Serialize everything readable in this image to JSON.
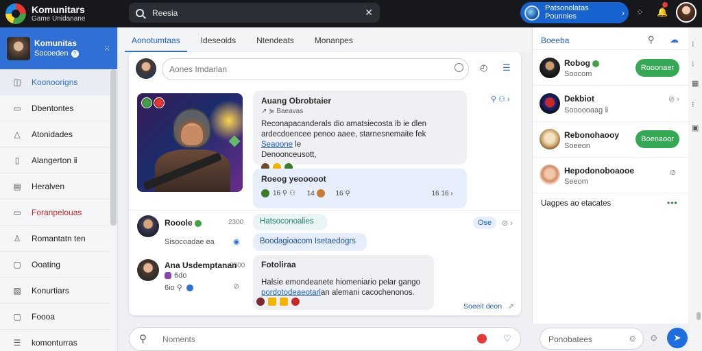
{
  "app": {
    "title": "Komunitars",
    "subtitle": "Game Unidanane"
  },
  "search": {
    "value": "Reesia",
    "clear_icon": "close-icon"
  },
  "account": {
    "name_line1": "Patsonolatas",
    "name_line2": "Pounnies",
    "arrow": "›"
  },
  "sidebar": {
    "user": {
      "name": "Komunitas",
      "sub": "Socoeden",
      "help": "?"
    },
    "items": [
      {
        "label": "Koonoorigns",
        "icon": "◫",
        "state": "active"
      },
      {
        "label": "Dbentontes",
        "icon": "▭",
        "state": ""
      },
      {
        "label": "Atonidades",
        "icon": "△",
        "state": ""
      },
      {
        "label": "Alangerton ⅱ",
        "icon": "▯",
        "state": ""
      },
      {
        "label": "Heralven",
        "icon": "▤",
        "state": ""
      },
      {
        "label": "Foranpelouas",
        "icon": "▭",
        "state": "red"
      },
      {
        "label": "Romantatn ten",
        "icon": "♙",
        "state": ""
      },
      {
        "label": "Ooating",
        "icon": "▢",
        "state": ""
      },
      {
        "label": "Konurtiars",
        "icon": "▧",
        "state": ""
      },
      {
        "label": "Foooa",
        "icon": "▢",
        "state": ""
      },
      {
        "label": "komonturras",
        "icon": "☰",
        "state": ""
      }
    ]
  },
  "tabs": [
    "Aonotumtaas",
    "Ideseolds",
    "Ntendeats",
    "Monanpes"
  ],
  "composer": {
    "placeholder": "Aones Imdarlan"
  },
  "post": {
    "title": "Auang Obrobtaier",
    "meta": "↗ ⋟ Baeavas",
    "body1": "Reconapacanderals dio amatsiecosta ib ie dlen",
    "body2": "ardecdoencee penoo aaee, starnesnemaite fek",
    "link": "Seaoone",
    "body2_tail": "le",
    "body3": "Denoonceusott,",
    "reply_title": "Roeog yeooooot",
    "reply_meta1": "16 ⚲ ⚇",
    "reply_meta2": "14",
    "reply_meta3": "16 ⚲",
    "reply_count": "16 16 ›",
    "share_icon": "⚲ ⚇ ›"
  },
  "comments": [
    {
      "name": "Rooole",
      "sub": "Sisocoadae ea",
      "time": "2300",
      "tag": "Hatsoconoalies",
      "text": "Boodagioacom Isetaedogrs",
      "pill": "Ose",
      "pill_side": "⊘ ›"
    },
    {
      "name": "Ana Usdemptanan",
      "sub1": "6do",
      "sub2": "6io ⚲",
      "time": "2300",
      "title": "Fotoliraa",
      "text1": "Halsie emondeanete hiomeniario pelar gango",
      "link": "pordotodeaeotarl",
      "text2": "an alemani cacochenonos.",
      "footer": "Soeeit deon",
      "footer_icon": "⇗"
    }
  ],
  "bottom": {
    "placeholder": "Noments"
  },
  "right": {
    "header": "Boeeba",
    "rows": [
      {
        "name": "Robog",
        "sub": "Soocom",
        "button": "Rooonaer"
      },
      {
        "name": "Dekbiot",
        "sub": "Soooooaag ⅱ",
        "icons": "⊘ ›"
      },
      {
        "name": "Rebonohaooy",
        "sub": "Soeeon",
        "button": "Boenaoor"
      },
      {
        "name": "Hepodonoboaooe",
        "sub": "Seeom",
        "icons": "⊘"
      }
    ],
    "more": "Uagpes ao etacates",
    "more_dots": "•••",
    "footer_placeholder": "Ponobatees"
  },
  "colors": {
    "brand": "#2f6fd6",
    "follow": "#34a853",
    "topbar": "#16181c"
  }
}
